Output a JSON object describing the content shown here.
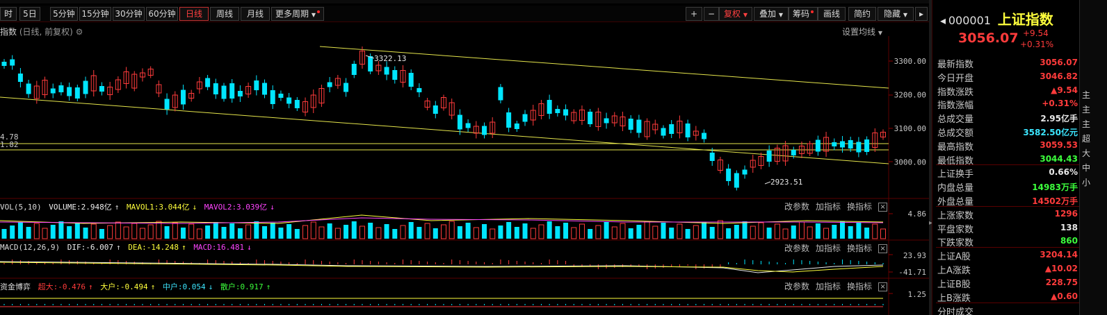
{
  "toolbar": {
    "items": [
      "日线",
      "周线",
      "月线",
      "更多周期"
    ],
    "periods": [
      "5日",
      "5分钟",
      "15分钟",
      "30分钟",
      "60分钟"
    ],
    "first_label": "时",
    "zoom_in": "+",
    "zoom_out": "−",
    "adjust_label": "复权",
    "overlay_label": "叠加",
    "chips_label": "筹码",
    "draw_label": "画线",
    "simple_label": "简约",
    "hide_label": "隐藏"
  },
  "chart": {
    "title": "指数",
    "subtitle": "(日线, 前复权)",
    "ma_setting": "设置均线",
    "price_ticks": [
      "3300.00",
      "3200.00",
      "3100.00",
      "3000.00"
    ],
    "left_labels": [
      "4.78",
      "1.82"
    ],
    "high_marker": "3322.13",
    "low_marker": "2923.51",
    "colors": {
      "up": "#ff3b3b",
      "down": "#00e5ff",
      "trend": "#e6e64c"
    }
  },
  "volume": {
    "name": "VOL(5,10)",
    "volume": "VOLUME:2.948亿",
    "mavol1": "MAVOL1:3.044亿",
    "mavol2": "MAVOL2:3.039亿",
    "axis_label": "4.86"
  },
  "macd": {
    "name": "MACD(12,26,9)",
    "dif": "DIF:-6.007",
    "dea": "DEA:-14.248",
    "macd": "MACD:16.481",
    "axis_top": "23.93",
    "axis_bottom": "-41.71"
  },
  "fund": {
    "name": "资金博弈",
    "super": "超大:-0.476",
    "large": "大户:-0.494",
    "mid": "中户:0.054",
    "retail": "散户:0.917",
    "axis_label": "1.25"
  },
  "panel_buttons": {
    "change_params": "改参数",
    "add_indicator": "加指标",
    "switch_indicator": "换指标",
    "close": "×"
  },
  "quote": {
    "code": "000001",
    "name": "上证指数",
    "price": "3056.07",
    "change": "+9.54",
    "change_pct": "+0.31%",
    "rows": [
      {
        "label": "最新指数",
        "value": "3056.07",
        "color": "red",
        "sep": false
      },
      {
        "label": "今日开盘",
        "value": "3046.82",
        "color": "red",
        "sep": false
      },
      {
        "label": "指数涨跌",
        "value": "▲9.54",
        "color": "red",
        "sep": false
      },
      {
        "label": "指数涨幅",
        "value": "+0.31%",
        "color": "red",
        "sep": false
      },
      {
        "label": "总成交量",
        "value": "2.95亿手",
        "color": "white",
        "sep": false
      },
      {
        "label": "总成交额",
        "value": "3582.50亿元",
        "color": "cyan",
        "sep": false
      },
      {
        "label": "最高指数",
        "value": "3059.53",
        "color": "red",
        "sep": false
      },
      {
        "label": "最低指数",
        "value": "3044.43",
        "color": "green",
        "sep": false
      },
      {
        "label": "上证换手",
        "value": "0.66%",
        "color": "white",
        "sep": true
      },
      {
        "label": "内盘总量",
        "value": "14983万手",
        "color": "green",
        "sep": false
      },
      {
        "label": "外盘总量",
        "value": "14502万手",
        "color": "red",
        "sep": false
      },
      {
        "label": "上涨家数",
        "value": "1296",
        "color": "red",
        "sep": true
      },
      {
        "label": "平盘家数",
        "value": "138",
        "color": "white",
        "sep": false
      },
      {
        "label": "下跌家数",
        "value": "860",
        "color": "green",
        "sep": false
      },
      {
        "label": "上证A股",
        "value": "3204.14",
        "color": "red",
        "sep": true
      },
      {
        "label": "上A涨跌",
        "value": "▲10.02",
        "color": "red",
        "sep": false
      },
      {
        "label": "上证B股",
        "value": "228.75",
        "color": "red",
        "sep": false
      },
      {
        "label": "上B涨跌",
        "value": "▲0.60",
        "color": "red",
        "sep": false
      }
    ],
    "tail_label": "分时成交"
  },
  "far_strip": [
    "主",
    "主",
    "主",
    "超",
    "大",
    "中",
    "小"
  ]
}
